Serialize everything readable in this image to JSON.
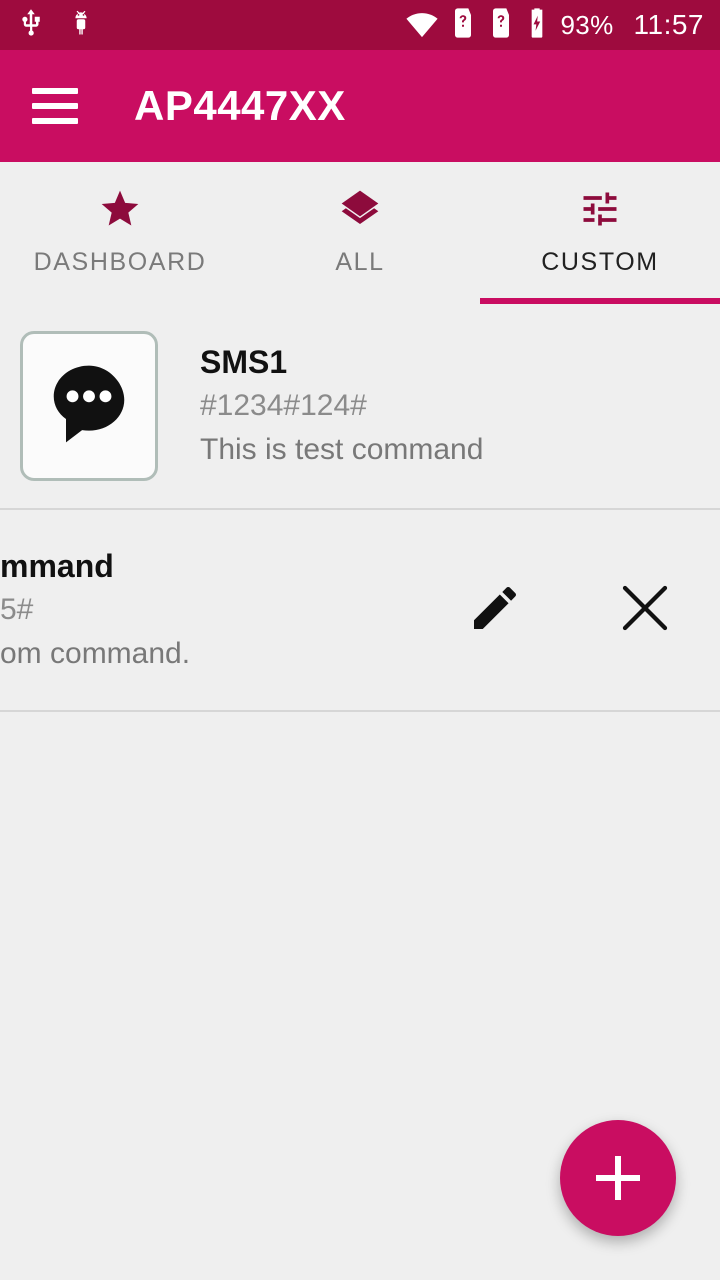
{
  "status_bar": {
    "left_icons": [
      {
        "name": "usb-icon",
        "label": "USB"
      },
      {
        "name": "android-debug-icon",
        "label": "Android"
      }
    ],
    "right_icons": [
      {
        "name": "wifi-icon",
        "label": "Wi-Fi"
      },
      {
        "name": "sim1-unknown-icon",
        "label": "SIM 1 unknown"
      },
      {
        "name": "sim2-unknown-icon",
        "label": "SIM 2 unknown"
      },
      {
        "name": "battery-charging-icon",
        "label": "Battery charging"
      }
    ],
    "battery_percent": "93%",
    "clock": "11:57"
  },
  "app_bar": {
    "menu_icon": "hamburger-menu-icon",
    "title": "AP4447XX",
    "background_color": "#c90d61"
  },
  "tabs": {
    "active_index": 2,
    "indicator_color": "#c90d61",
    "items": [
      {
        "label": "DASHBOARD",
        "icon": "star-icon",
        "active": false
      },
      {
        "label": "ALL",
        "icon": "layers-icon",
        "active": false
      },
      {
        "label": "CUSTOM",
        "icon": "tune-sliders-icon",
        "active": true
      }
    ]
  },
  "list": {
    "rows": [
      {
        "title": "SMS1",
        "code": "#1234#124#",
        "description": "This is test command",
        "icon": "sms-chat-bubble-icon",
        "swiped": false
      },
      {
        "title": "mmand",
        "code": "5#",
        "description": "om command.",
        "icon": "sms-chat-bubble-icon",
        "swiped": true,
        "actions": [
          {
            "name": "edit-button",
            "icon": "pencil-icon"
          },
          {
            "name": "delete-button",
            "icon": "close-x-icon"
          }
        ]
      }
    ]
  },
  "fab": {
    "icon": "plus-icon",
    "label": "Add custom command",
    "color": "#c90d61"
  },
  "theme": {
    "primary": "#c90d61",
    "status_bar": "#9e0b3e",
    "accent_dark": "#8d0b3c",
    "background": "#efefef"
  }
}
